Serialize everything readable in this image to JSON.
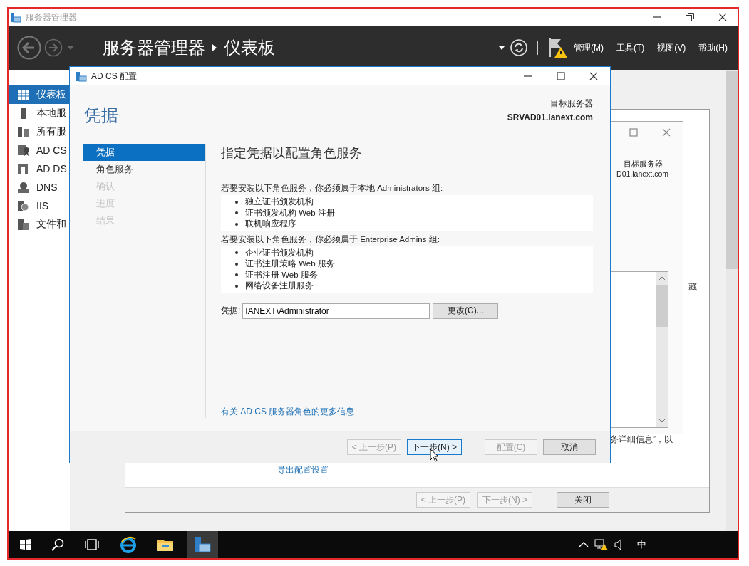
{
  "main_window": {
    "title": "服务器管理器",
    "breadcrumb": [
      "服务器管理器",
      "仪表板"
    ],
    "menus": [
      "管理(M)",
      "工具(T)",
      "视图(V)",
      "帮助(H)"
    ]
  },
  "nav": [
    {
      "label": "仪表板",
      "selected": true
    },
    {
      "label": "本地服",
      "selected": false
    },
    {
      "label": "所有服",
      "selected": false
    },
    {
      "label": "AD CS",
      "selected": false
    },
    {
      "label": "AD DS",
      "selected": false
    },
    {
      "label": "DNS",
      "selected": false
    },
    {
      "label": "IIS",
      "selected": false
    },
    {
      "label": "文件和",
      "selected": false
    }
  ],
  "background_wizard": {
    "link": "导出配置设置",
    "side_texts": [
      "藏",
      "务详细信息”，以"
    ],
    "buttons": [
      {
        "label": "< 上一步(P)",
        "disabled": true
      },
      {
        "label": "下一步(N) >",
        "disabled": true
      },
      {
        "label": "关闭",
        "disabled": false
      }
    ]
  },
  "inner_window": {
    "target_label": "目标服务器",
    "target_server": "D01.ianext.com"
  },
  "dialog": {
    "title": "AD CS 配置",
    "heading": "凭据",
    "target_label": "目标服务器",
    "target_server": "SRVAD01.ianext.com",
    "steps": [
      {
        "label": "凭据",
        "selected": true,
        "disabled": false
      },
      {
        "label": "角色服务",
        "selected": false,
        "disabled": false
      },
      {
        "label": "确认",
        "selected": false,
        "disabled": true
      },
      {
        "label": "进度",
        "selected": false,
        "disabled": true
      },
      {
        "label": "结果",
        "selected": false,
        "disabled": true
      }
    ],
    "page_heading": "指定凭据以配置角色服务",
    "groups": [
      {
        "intro": "若要安装以下角色服务，你必须属于本地 Administrators 组:",
        "items": [
          "独立证书颁发机构",
          "证书颁发机构 Web 注册",
          "联机响应程序"
        ]
      },
      {
        "intro": "若要安装以下角色服务，你必须属于 Enterprise Admins 组:",
        "items": [
          "企业证书颁发机构",
          "证书注册策略 Web 服务",
          "证书注册 Web 服务",
          "网络设备注册服务"
        ]
      }
    ],
    "credential": {
      "label": "凭据:",
      "value": "IANEXT\\Administrator",
      "button": "更改(C)..."
    },
    "link": "有关 AD CS 服务器角色的更多信息",
    "buttons": [
      {
        "label": "< 上一步(P)",
        "disabled": true,
        "default": false
      },
      {
        "label": "下一步(N) >",
        "disabled": false,
        "default": true
      },
      {
        "label": "配置(C)",
        "disabled": true,
        "default": false
      },
      {
        "label": "取消",
        "disabled": false,
        "default": false
      }
    ]
  },
  "taskbar": {
    "input_method": "中"
  }
}
